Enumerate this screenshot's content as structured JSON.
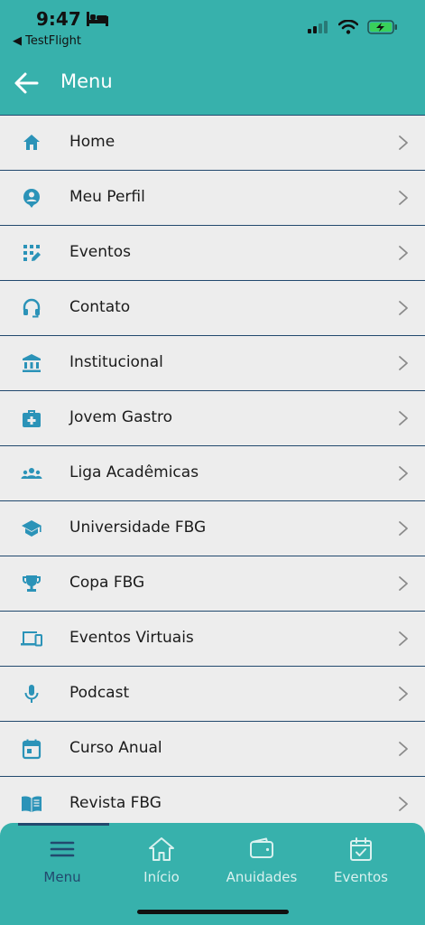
{
  "status_bar": {
    "time": "9:47",
    "back_app": "◀ TestFlight"
  },
  "header": {
    "title": "Menu"
  },
  "menu": {
    "items": [
      {
        "label": "Home",
        "icon": "home-icon"
      },
      {
        "label": "Meu Perfil",
        "icon": "profile-icon"
      },
      {
        "label": "Eventos",
        "icon": "events-grid-icon"
      },
      {
        "label": "Contato",
        "icon": "headset-icon"
      },
      {
        "label": "Institucional",
        "icon": "institution-icon"
      },
      {
        "label": "Jovem Gastro",
        "icon": "medical-bag-icon"
      },
      {
        "label": "Liga Acadêmicas",
        "icon": "group-icon"
      },
      {
        "label": "Universidade FBG",
        "icon": "graduation-cap-icon"
      },
      {
        "label": "Copa FBG",
        "icon": "trophy-icon"
      },
      {
        "label": "Eventos Virtuais",
        "icon": "devices-icon"
      },
      {
        "label": "Podcast",
        "icon": "microphone-icon"
      },
      {
        "label": "Curso Anual",
        "icon": "calendar-icon"
      },
      {
        "label": "Revista FBG",
        "icon": "book-icon"
      }
    ]
  },
  "bottom_nav": {
    "items": [
      {
        "label": "Menu",
        "icon": "menu-icon",
        "active": true
      },
      {
        "label": "Início",
        "icon": "home-icon",
        "active": false
      },
      {
        "label": "Anuidades",
        "icon": "wallet-icon",
        "active": false
      },
      {
        "label": "Eventos",
        "icon": "calendar-check-icon",
        "active": false
      }
    ]
  },
  "colors": {
    "brand_teal": "#37b1ac",
    "icon_teal": "#2b93b8",
    "navy": "#22496e",
    "background": "#ededed"
  }
}
